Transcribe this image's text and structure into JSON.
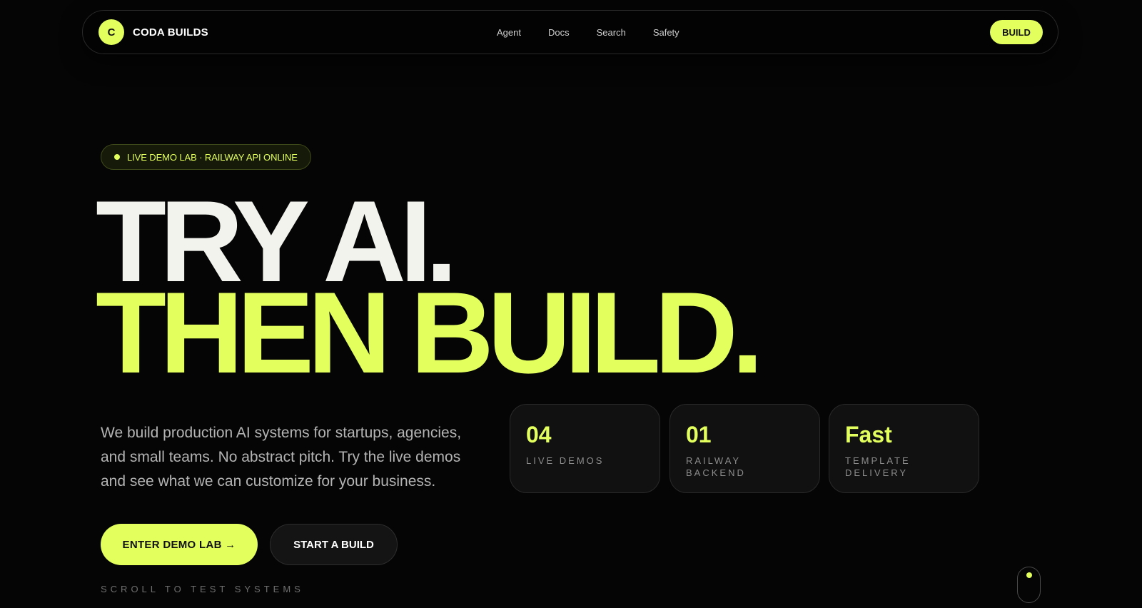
{
  "nav": {
    "brand_logo": "C",
    "brand_name": "CODA BUILDS",
    "links": [
      "Agent",
      "Docs",
      "Search",
      "Safety"
    ],
    "cta": "BUILD"
  },
  "badge": {
    "text": "LIVE DEMO LAB · RAILWAY API ONLINE"
  },
  "hero": {
    "line1": "TRY AI.",
    "line2": "THEN BUILD.",
    "description": "We build production AI systems for startups, agencies, and small teams. No abstract pitch. Try the live demos and see what we can customize for your business."
  },
  "stats": [
    {
      "value": "04",
      "label": "LIVE DEMOS"
    },
    {
      "value": "01",
      "label": "RAILWAY BACKEND"
    },
    {
      "value": "Fast",
      "label": "TEMPLATE DELIVERY"
    }
  ],
  "buttons": {
    "primary": "ENTER DEMO LAB →",
    "secondary": "START A BUILD"
  },
  "scroll_hint": "SCROLL TO TEST SYSTEMS",
  "colors": {
    "accent": "#e2ff5e",
    "background": "#050505"
  }
}
